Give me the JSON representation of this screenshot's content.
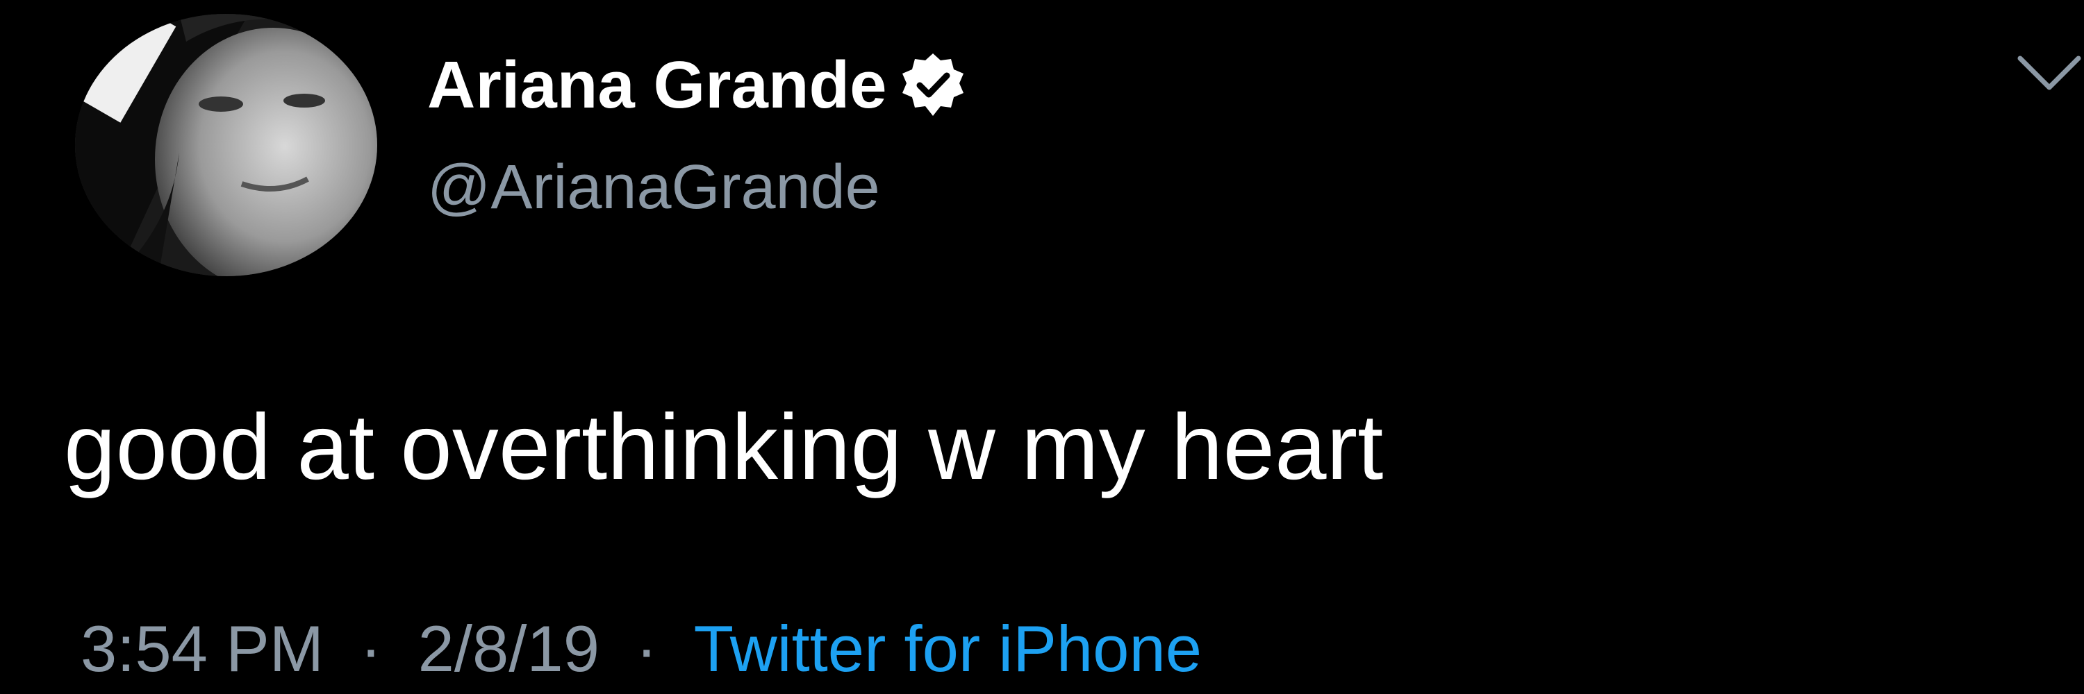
{
  "tweet": {
    "author": {
      "display_name": "Ariana Grande",
      "handle": "@ArianaGrande",
      "verified": true
    },
    "text": "good at overthinking w my heart",
    "time": "3:54 PM",
    "date": "2/8/19",
    "separator": "·",
    "source": "Twitter for iPhone"
  },
  "icons": {
    "avatar": "avatar-photo",
    "verified": "verified-badge-icon",
    "menu": "chevron-down-icon"
  },
  "colors": {
    "background": "#000000",
    "primary_text": "#ffffff",
    "secondary_text": "#8b98a5",
    "link": "#1da1f2"
  }
}
